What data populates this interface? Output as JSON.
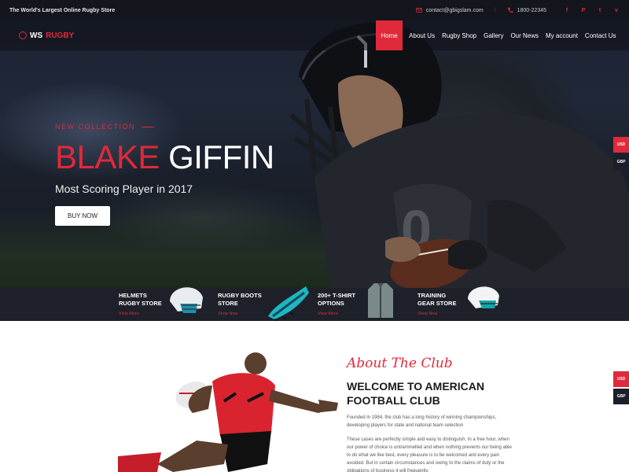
{
  "topbar": {
    "tagline": "The World's Largest Online Rugby Store",
    "email": "contact@gbigslam.com",
    "phone": "1800-22345",
    "socials": [
      "f",
      "P",
      "t",
      "v"
    ]
  },
  "brand": {
    "part1": "WS",
    "part2": "RUGBY"
  },
  "nav": {
    "items": [
      "Home",
      "About Us",
      "Rugby Shop",
      "Gallery",
      "Our News",
      "My account",
      "Contact Us"
    ],
    "active": "Home"
  },
  "hero": {
    "eyebrow": "NEW COLLECTION",
    "name_first": "BLAKE",
    "name_last": "GIFFIN",
    "subtitle": "Most Scoring Player in 2017",
    "button": "BUY NOW"
  },
  "currency": {
    "usd": "USD",
    "gbp": "GBP"
  },
  "categories": [
    {
      "line1": "HELMETS",
      "line2": "RUGBY STORE",
      "link": "View More",
      "icon": "helmet-icon"
    },
    {
      "line1": "RUGBY BOOTS",
      "line2": "STORE",
      "link": "Shop Now",
      "icon": "boot-icon"
    },
    {
      "line1": "200+ T-SHIRT",
      "line2": "OPTIONS",
      "link": "View More",
      "icon": "jacket-icon"
    },
    {
      "line1": "TRAINING",
      "line2": "GEAR STORE",
      "link": "Shop Now",
      "icon": "training-helmet-icon"
    }
  ],
  "about": {
    "script_title": "About The Club",
    "heading_line1": "WELCOME TO AMERICAN",
    "heading_line2": "FOOTBALL CLUB",
    "para1": "Founded in 1984, the club has a long history of winning championships, developing players for state and national team selection",
    "para2": "These cases are perfectly simple and easy to distinguish. In a free hour, when our power of choice is untrammelled and when nothing prevents our being able to do what we like best, every pleasure is to be welcomed and every pain avoided. But in certain circumstances and owing to the claims of duty or the obligations of business it will frequently."
  },
  "colors": {
    "accent": "#e0293a",
    "dark": "#14161d"
  }
}
